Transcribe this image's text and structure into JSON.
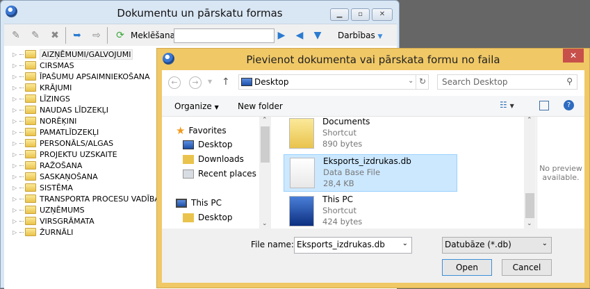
{
  "main_window": {
    "title": "Dokumentu un pārskatu formas",
    "toolbar": {
      "search_label": "Meklēšana:",
      "search_value": "",
      "actions_label": "Darbības"
    },
    "tree": [
      "AIZŅĒMUMI/GALVOJUMI",
      "CIRSMAS",
      "ĪPAŠUMU APSAIMNIEKOŠANA",
      "KRĀJUMI",
      "LĪZINGS",
      "NAUDAS LĪDZEKĻI",
      "NORĒĶINI",
      "PAMATLĪDZEKĻI",
      "PERSONĀLS/ALGAS",
      "PROJEKTU UZSKAITE",
      "RAŽOŠANA",
      "SASKAŅOŠANA",
      "SISTĒMA",
      "TRANSPORTA PROCESU VADĪBA",
      "UZŅĒMUMS",
      "VIRSGRĀMATA",
      "ŽURNĀLI"
    ],
    "selected_tree_item": "AIZŅĒMUMI/GALVOJUMI"
  },
  "dialog": {
    "title": "Pievienot dokumenta vai pārskata formu no faila",
    "address": "Desktop",
    "search_placeholder": "Search Desktop",
    "organize": "Organize",
    "new_folder": "New folder",
    "nav": {
      "favorites": "Favorites",
      "fav_items": [
        "Desktop",
        "Downloads",
        "Recent places"
      ],
      "this_pc": "This PC",
      "pc_items": [
        "Desktop"
      ]
    },
    "files": [
      {
        "name": "Documents",
        "type": "Shortcut",
        "size": "890 bytes"
      },
      {
        "name": "Eksports_izdrukas.db",
        "type": "Data Base File",
        "size": "28,4 KB",
        "selected": true
      },
      {
        "name": "This PC",
        "type": "Shortcut",
        "size": "424 bytes"
      }
    ],
    "preview": "No preview available.",
    "file_name_label": "File name:",
    "file_name_value": "Eksports_izdrukas.db",
    "file_type": "Datubāze (*.db)",
    "open": "Open",
    "cancel": "Cancel"
  },
  "colors": {
    "dialog_frame": "#f0c866",
    "close": "#c7504a",
    "selection": "#cce8ff"
  }
}
